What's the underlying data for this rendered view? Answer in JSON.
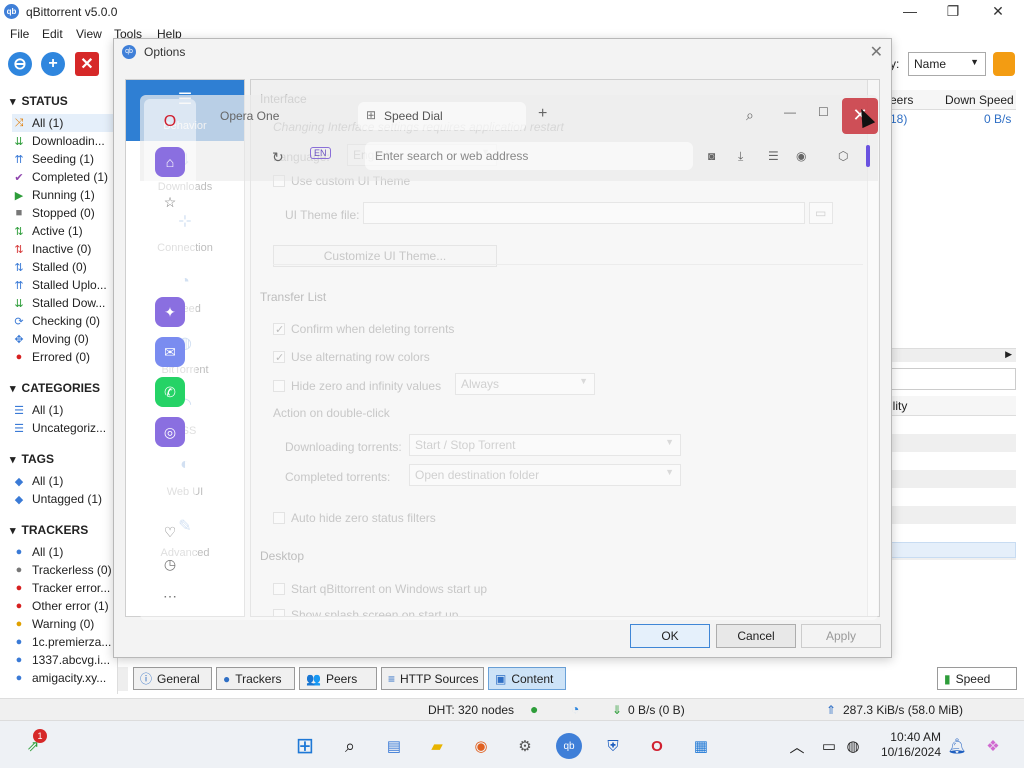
{
  "app": {
    "title": "qBittorrent v5.0.0",
    "icon_text": "qb"
  },
  "menu": [
    "File",
    "Edit",
    "View",
    "Tools",
    "Help"
  ],
  "toolbar": {
    "sort_label": "y:",
    "sort_value": "Name"
  },
  "sidebar": {
    "status_title": "STATUS",
    "status_items": [
      {
        "label": "All (1)",
        "icon": "all-icon",
        "color": "#e07b00"
      },
      {
        "label": "Downloadin...",
        "icon": "download-icon",
        "color": "#2e9d3a"
      },
      {
        "label": "Seeding (1)",
        "icon": "upload-icon",
        "color": "#3a7ad6"
      },
      {
        "label": "Completed (1)",
        "icon": "check-icon",
        "color": "#8e44ad"
      },
      {
        "label": "Running (1)",
        "icon": "play-icon",
        "color": "#2e9d3a"
      },
      {
        "label": "Stopped (0)",
        "icon": "stop-icon",
        "color": "#777777"
      },
      {
        "label": "Active (1)",
        "icon": "updown-icon",
        "color": "#2e9d3a"
      },
      {
        "label": "Inactive (0)",
        "icon": "updown-red-icon",
        "color": "#d63a3a"
      },
      {
        "label": "Stalled (0)",
        "icon": "stalled-icon",
        "color": "#3a7ad6"
      },
      {
        "label": "Stalled Uplo...",
        "icon": "stalled-up-icon",
        "color": "#3a7ad6"
      },
      {
        "label": "Stalled Dow...",
        "icon": "stalled-down-icon",
        "color": "#2e9d3a"
      },
      {
        "label": "Checking (0)",
        "icon": "refresh-icon",
        "color": "#3a7ad6"
      },
      {
        "label": "Moving (0)",
        "icon": "move-icon",
        "color": "#3a7ad6"
      },
      {
        "label": "Errored (0)",
        "icon": "error-icon",
        "color": "#d62020"
      }
    ],
    "categories_title": "CATEGORIES",
    "categories": [
      "All (1)",
      "Uncategoriz..."
    ],
    "tags_title": "TAGS",
    "tags": [
      "All (1)",
      "Untagged (1)"
    ],
    "trackers_title": "TRACKERS",
    "trackers": [
      {
        "label": "All (1)",
        "color": "#3a7ad6"
      },
      {
        "label": "Trackerless (0)",
        "color": "#777777"
      },
      {
        "label": "Tracker error...",
        "color": "#d62020"
      },
      {
        "label": "Other error (1)",
        "color": "#d62020"
      },
      {
        "label": "Warning (0)",
        "color": "#e0a000"
      },
      {
        "label": "1c.premierza...",
        "color": "#3a7ad6"
      },
      {
        "label": "1337.abcvg.i...",
        "color": "#3a7ad6"
      },
      {
        "label": "amigacity.xy...",
        "color": "#3a7ad6"
      }
    ]
  },
  "right_pane": {
    "col_peers": "eers",
    "col_down": "Down Speed",
    "row_peers": "18)",
    "row_down": "0 B/s",
    "avail_header": "ility"
  },
  "bottom_tabs": [
    {
      "label": "General",
      "icon": "info-icon"
    },
    {
      "label": "Trackers",
      "icon": "pin-icon"
    },
    {
      "label": "Peers",
      "icon": "people-icon"
    },
    {
      "label": "HTTP Sources",
      "icon": "server-icon"
    },
    {
      "label": "Content",
      "icon": "folder-icon"
    }
  ],
  "speed_button": "Speed",
  "status": {
    "dht": "DHT: 320 nodes",
    "down": "0 B/s (0 B)",
    "up": "287.3 KiB/s (58.0 MiB)"
  },
  "dialog": {
    "title": "Options",
    "categories": [
      {
        "label": "Behavior",
        "icon": "behavior-icon"
      },
      {
        "label": "Downloads",
        "icon": "downloads-icon"
      },
      {
        "label": "Connection",
        "icon": "connection-icon"
      },
      {
        "label": "Speed",
        "icon": "speed-icon"
      },
      {
        "label": "BitTorrent",
        "icon": "bittorrent-icon"
      },
      {
        "label": "RSS",
        "icon": "rss-icon"
      },
      {
        "label": "Web UI",
        "icon": "webui-icon"
      },
      {
        "label": "Advanced",
        "icon": "advanced-icon"
      }
    ],
    "interface_group": "Interface",
    "restart_note": "Changing Interface settings requires application restart",
    "language_label": "Language:",
    "language_value": "English",
    "custom_theme": "Use custom UI Theme",
    "theme_file_label": "UI Theme file:",
    "customize_theme": "Customize UI Theme...",
    "transfer_group": "Transfer List",
    "confirm_delete": "Confirm when deleting torrents",
    "alt_rows": "Use alternating row colors",
    "hide_zero": "Hide zero and infinity values",
    "hide_zero_mode": "Always",
    "double_click_group": "Action on double-click",
    "downloading_label": "Downloading torrents:",
    "downloading_value": "Start / Stop Torrent",
    "completed_label": "Completed torrents:",
    "completed_value": "Open destination folder",
    "auto_hide": "Auto hide zero status filters",
    "desktop_group": "Desktop",
    "start_windows": "Start qBittorrent on Windows start up",
    "show_splash": "Show splash screen on start up",
    "ok": "OK",
    "cancel": "Cancel",
    "apply": "Apply"
  },
  "opera": {
    "tab1": "Opera One",
    "tab2": "Speed Dial",
    "address_placeholder": "Enter search or web address",
    "lang_badge": "EN"
  },
  "taskbar": {
    "time": "10:40 AM",
    "date": "10/16/2024",
    "notify_badge": "1"
  }
}
